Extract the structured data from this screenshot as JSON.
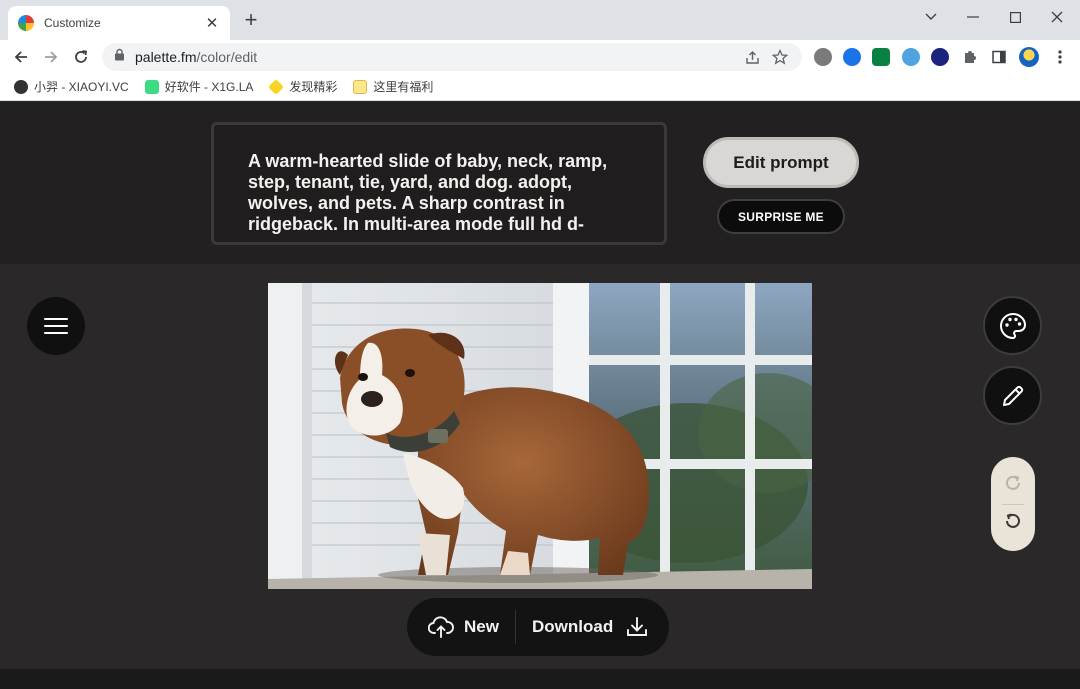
{
  "browser": {
    "tab_title": "Customize",
    "new_tab": "+",
    "url_host": "palette.fm",
    "url_path": "/color/edit",
    "bookmarks": [
      {
        "label": "小羿 - XIAOYI.VC"
      },
      {
        "label": "好软件 - X1G.LA"
      },
      {
        "label": "发现精彩"
      },
      {
        "label": "这里有福利"
      }
    ]
  },
  "prompt": {
    "text": "A warm-hearted slide of baby, neck, ramp, step, tenant, tie, yard, and dog. adopt, wolves, and pets. A sharp contrast in ridgeback. In multi-area mode full hd d-",
    "edit_label": "Edit prompt",
    "surprise_label": "SURPRISE ME"
  },
  "actions": {
    "new_label": "New",
    "download_label": "Download"
  },
  "colors": {
    "page_bg": "#2a2828",
    "header_bg": "#222020",
    "accent_light": "#d9d6d4",
    "pill_bg": "#eae4d8"
  }
}
